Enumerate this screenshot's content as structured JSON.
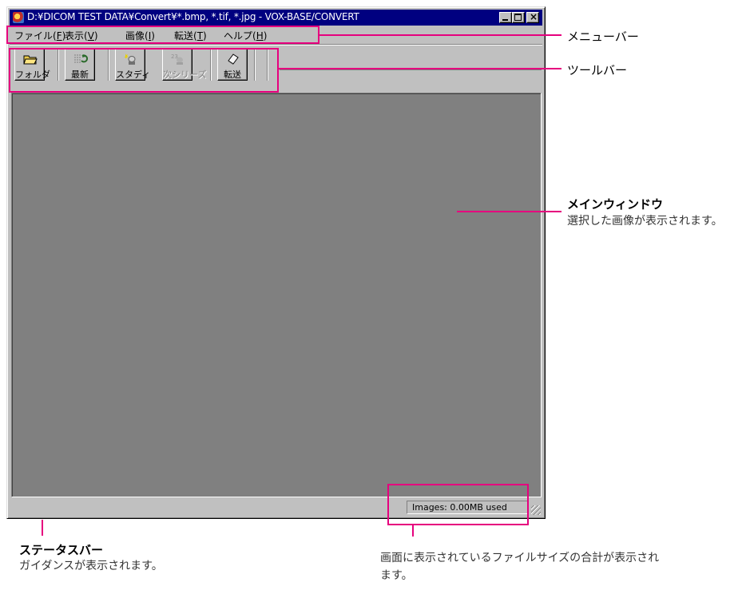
{
  "window": {
    "title": "D:¥DICOM TEST DATA¥Convert¥*.bmp, *.tif, *.jpg - VOX-BASE/CONVERT",
    "close_glyph": "×"
  },
  "menubar": {
    "items": [
      {
        "label": "ファイル(",
        "key": "F",
        "suffix": ")"
      },
      {
        "label": "表示(",
        "key": "V",
        "suffix": ")"
      },
      {
        "label": "画像(",
        "key": "I",
        "suffix": ")"
      },
      {
        "label": "転送(",
        "key": "T",
        "suffix": ")"
      },
      {
        "label": "ヘルプ(",
        "key": "H",
        "suffix": ")"
      }
    ]
  },
  "toolbar": {
    "buttons": [
      {
        "label": "フォルダ",
        "icon": "folder-open-icon",
        "enabled": true
      },
      {
        "label": "最新",
        "icon": "refresh-grid-icon",
        "enabled": true
      },
      {
        "label": "スタディ",
        "icon": "study-icon",
        "enabled": true
      },
      {
        "label": "次シリーズ",
        "icon": "next-series-icon",
        "enabled": false
      },
      {
        "label": "転送",
        "icon": "transfer-icon",
        "enabled": true
      }
    ]
  },
  "statusbar": {
    "guidance": "",
    "memory": "Images: 0.00MB used"
  },
  "callouts": {
    "menubar": "メニューバー",
    "toolbar": "ツールバー",
    "main_title": "メインウィンドウ",
    "main_desc": "選択した画像が表示されます。",
    "status_title": "ステータスバー",
    "status_desc": "ガイダンスが表示されます。",
    "size_desc": "画面に表示されているファイルサイズの合計が表示されます。"
  },
  "colors": {
    "callout": "#e6007e",
    "titlebar": "#000080",
    "workspace": "#808080",
    "face": "#c0c0c0"
  }
}
